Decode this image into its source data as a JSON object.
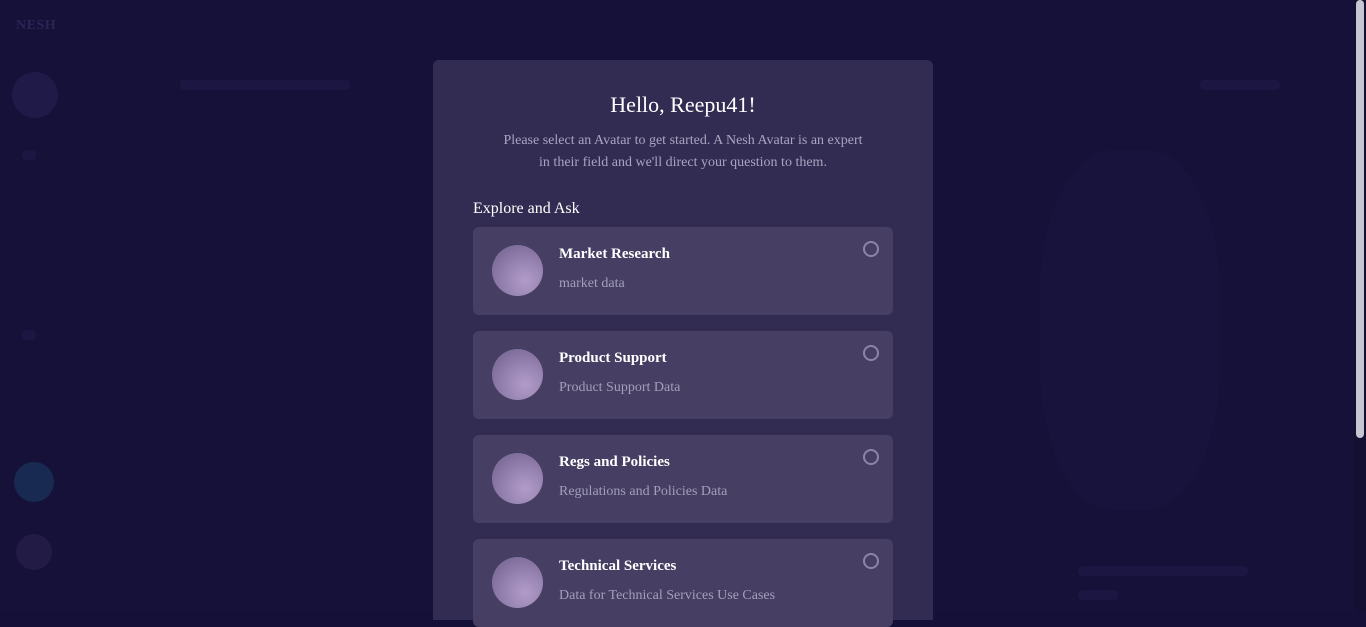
{
  "background": {
    "logo_text": "NESH"
  },
  "modal": {
    "title": "Hello, Reepu41!",
    "subtitle": "Please select an Avatar to get started. A Nesh Avatar is an expert in their field and we'll direct your question to them.",
    "section_label": "Explore and Ask",
    "avatars": [
      {
        "title": "Market Research",
        "description": "market data",
        "selected": false
      },
      {
        "title": "Product Support",
        "description": "Product Support Data",
        "selected": false
      },
      {
        "title": "Regs and Policies",
        "description": "Regulations and Policies Data",
        "selected": false
      },
      {
        "title": "Technical Services",
        "description": "Data for Technical Services Use Cases",
        "selected": false
      }
    ]
  },
  "colors": {
    "backdrop": "#161139",
    "modal": "#322c52",
    "card": "#463f63",
    "text_primary": "#ffffff",
    "text_secondary": "#a9a4c1"
  }
}
